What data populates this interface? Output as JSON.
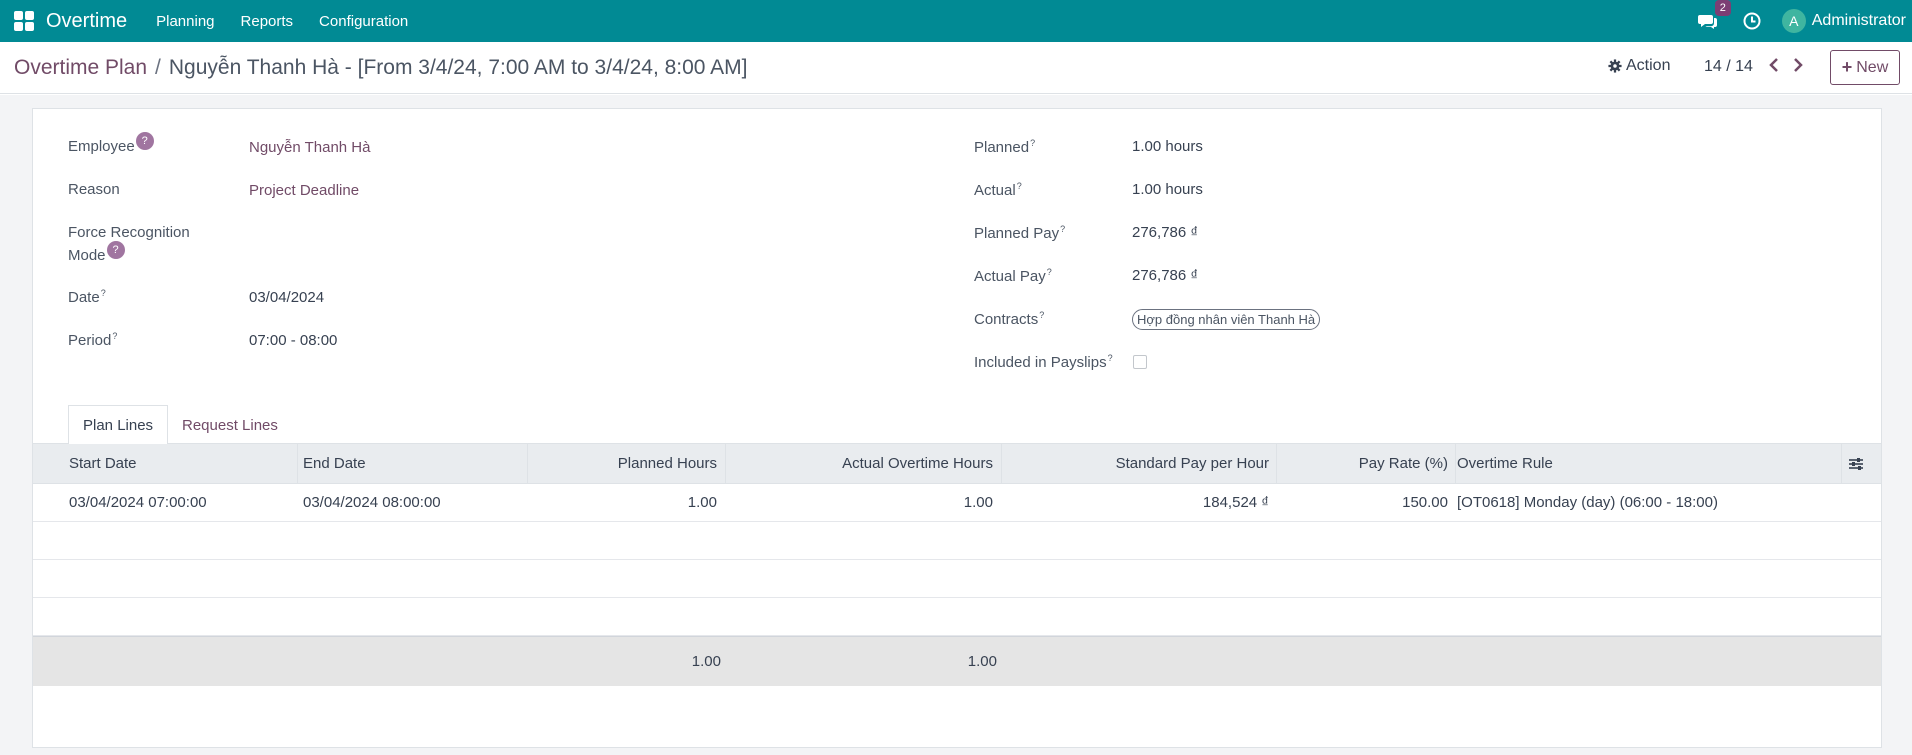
{
  "navbar": {
    "brand": "Overtime",
    "menu": [
      "Planning",
      "Reports",
      "Configuration"
    ],
    "chat_count": "2",
    "user_initial": "A",
    "user_name": "Administrator",
    "bg_color": "#018a94"
  },
  "breadcrumb": {
    "parent": "Overtime Plan",
    "separator": "/",
    "current": "Nguyễn Thanh Hà - [From 3/4/24, 7:00 AM to 3/4/24, 8:00 AM]"
  },
  "toolbar": {
    "action_label": "Action",
    "pager": "14 / 14",
    "new_label": "New"
  },
  "form": {
    "left": {
      "employee_label": "Employee",
      "employee_value": "Nguyễn Thanh Hà",
      "reason_label": "Reason",
      "reason_value": "Project Deadline",
      "force_label_1": "Force Recognition",
      "force_label_2": "Mode",
      "date_label": "Date",
      "date_value": "03/04/2024",
      "period_label": "Period",
      "period_value": "07:00 - 08:00",
      "help_glyph": "?",
      "sup_glyph": "?"
    },
    "right": {
      "planned_label": "Planned",
      "planned_value": "1.00 hours",
      "actual_label": "Actual",
      "actual_value": "1.00 hours",
      "planned_pay_label": "Planned Pay",
      "planned_pay_value": "276,786 ₫",
      "actual_pay_label": "Actual Pay",
      "actual_pay_value": "276,786 ₫",
      "contracts_label": "Contracts",
      "contracts_tag": "Hợp đồng nhân viên Thanh Hà",
      "payslips_label": "Included in Payslips",
      "payslips_checked": false
    }
  },
  "tabs": [
    {
      "label": "Plan Lines",
      "active": true
    },
    {
      "label": "Request Lines",
      "active": false
    }
  ],
  "table": {
    "columns": [
      "Start Date",
      "End Date",
      "Planned Hours",
      "Actual Overtime Hours",
      "Standard Pay per Hour",
      "Pay Rate (%)",
      "Overtime Rule"
    ],
    "rows": [
      [
        "03/04/2024 07:00:00",
        "03/04/2024 08:00:00",
        "1.00",
        "1.00",
        "184,524 ₫",
        "150.00",
        "[OT0618] Monday (day) (06:00 - 18:00)"
      ]
    ],
    "totals": {
      "planned_hours": "1.00",
      "actual_hours": "1.00"
    }
  }
}
